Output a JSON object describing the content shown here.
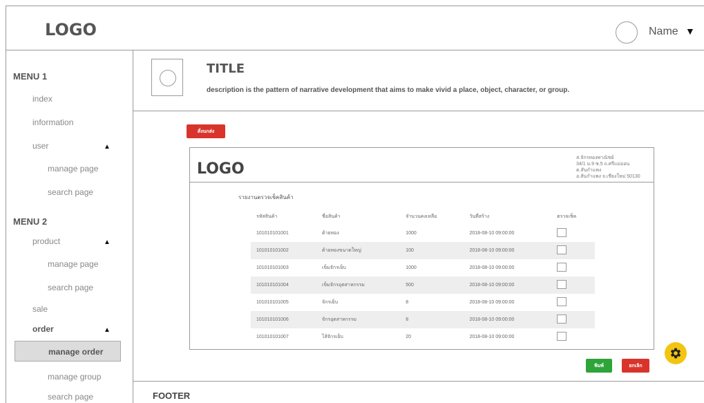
{
  "header": {
    "logo": "LOGO",
    "user_name": "Name",
    "caret": "▼"
  },
  "sidebar": {
    "menu1": "MENU 1",
    "menu1_items": [
      "index",
      "information",
      "user",
      "manage page",
      "search page"
    ],
    "menu2": "MENU 2",
    "menu2_items": [
      "product",
      "manage page",
      "search page",
      "sale",
      "order",
      "manage order",
      "manage group",
      "search page"
    ],
    "arrow": "▲"
  },
  "content": {
    "title": "TITLE",
    "description": "description is the pattern of narrative development that aims to make vivid a place, object, character, or group.",
    "top_button": "สั่งนกส่ง",
    "print_button": "พิมพ์",
    "cancel_button": "ยกเลิก"
  },
  "report": {
    "logo": "LOGO",
    "address": [
      "ส.จักรทองพาณิชย์",
      "34/1 ม.9 ซ.5 ถ.ศรีแม่ออน ต.สันกำแพง",
      "อ.สันกำแพง จ.เชียงใหม่ 50130"
    ],
    "subtitle": "รายงานตรวจเช็คสินค้า",
    "columns": [
      "รหัสสินค้า",
      "ชื่อสินค้า",
      "จำนวนคงเหลือ",
      "วันที่สร้าง",
      "ตรวจเช็ค"
    ],
    "rows": [
      [
        "101010101001",
        "ด้ายทอง",
        "1000",
        "2018-08-10 09:00:00"
      ],
      [
        "101010101002",
        "ด้ายทองขนาดใหญ่",
        "100",
        "2018-08-10 09:00:00"
      ],
      [
        "101010101003",
        "เข็มจักรเย็บ",
        "1000",
        "2018-08-10 09:00:00"
      ],
      [
        "101010101004",
        "เข็มจักรอุตสาหกรรม",
        "500",
        "2018-08-10 09:00:00"
      ],
      [
        "101010101005",
        "จักรเย็บ",
        "8",
        "2018-08-10 09:00:00"
      ],
      [
        "101010101006",
        "จักรอุตสาหกรรม",
        "8",
        "2018-08-10 09:00:00"
      ],
      [
        "101010101007",
        "ไส้จักรเย็บ",
        "20",
        "2018-08-10 09:00:00"
      ]
    ]
  },
  "footer": {
    "label": "FOOTER"
  },
  "colors": {
    "red": "#d9342b",
    "green": "#2ea43a",
    "gear": "#f3c510",
    "active_bg": "#dcdcdc"
  },
  "icons": {
    "settings": "gear-icon",
    "avatar": "avatar-circle",
    "image": "image-placeholder"
  }
}
